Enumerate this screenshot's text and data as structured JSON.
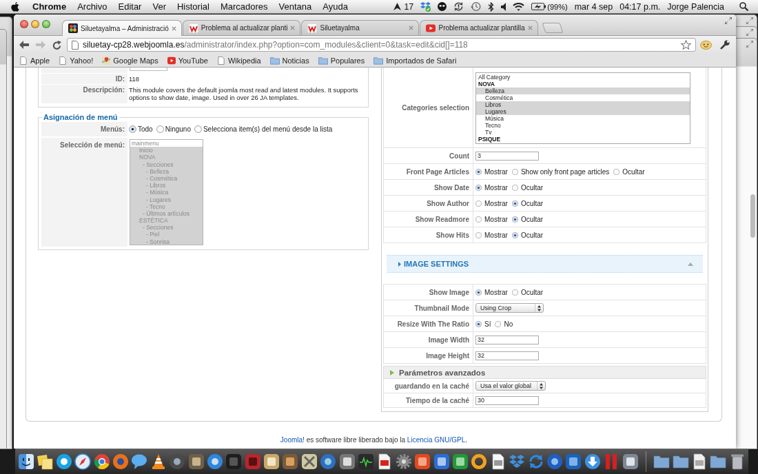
{
  "menu_bar": {
    "app": "Chrome",
    "menus": [
      "Archivo",
      "Editar",
      "Ver",
      "Historial",
      "Marcadores",
      "Ventana",
      "Ayuda"
    ],
    "status": {
      "count": "17",
      "battery": "(99%)",
      "date": "mar 4 sep",
      "time": "04:17 p.m.",
      "user": "Jorge Palencia"
    }
  },
  "browser": {
    "tabs": [
      {
        "kind": "logo",
        "title": "Siluetayalma – Administració",
        "selected": true
      },
      {
        "kind": "letter",
        "title": "Problema al actualizar planti",
        "selected": false
      },
      {
        "kind": "letter",
        "title": "Siluetayalma",
        "selected": false
      },
      {
        "kind": "video",
        "title": "Problema actualizar plantilla",
        "selected": false
      }
    ],
    "nav_buttons": [
      {
        "kind": "back",
        "disabled": false
      },
      {
        "kind": "forward",
        "disabled": true
      },
      {
        "kind": "reload",
        "disabled": false
      }
    ],
    "address": {
      "host": "siluetay-cp28.webjoomla.es",
      "path": "/administrator/index.php?option=com_modules&client=0&task=edit&cid[]=118"
    },
    "bookmarks": [
      {
        "kind": "page",
        "label": "Apple"
      },
      {
        "kind": "page",
        "label": "Yahoo!"
      },
      {
        "kind": "map",
        "label": "Google Maps"
      },
      {
        "kind": "video",
        "label": "YouTube"
      },
      {
        "kind": "page",
        "label": "Wikipedia"
      },
      {
        "kind": "folder",
        "label": "Noticias"
      },
      {
        "kind": "folder",
        "label": "Populares"
      },
      {
        "kind": "folder",
        "label": "Importados de Safari"
      }
    ]
  },
  "details": {
    "rows": [
      {
        "kind": "field"
      },
      {
        "kind": "text",
        "label": "ID:",
        "value": "118"
      },
      {
        "kind": "text",
        "label": "Descripción:",
        "value": "This module covers the default joomla most read and latest modules. It supports options to show date, image. Used in over 26 JA templates."
      }
    ]
  },
  "menu_assignment": {
    "legend": "Asignación de menú",
    "menus": {
      "label": "Menús:",
      "options": [
        {
          "label": "Todo",
          "selected": true
        },
        {
          "label": "Ninguno",
          "selected": false
        },
        {
          "label": "Selecciona item(s) del menú desde la lista",
          "selected": false
        }
      ]
    },
    "selection": {
      "label": "Selección de menú:",
      "disabled": true,
      "items": [
        {
          "label": "mainmenu",
          "selected": false,
          "children": [
            {
              "label": "Inicio",
              "selected": true
            },
            {
              "label": "NOVA",
              "selected": true,
              "children": [
                {
                  "label": "- Secciones",
                  "selected": true,
                  "children": [
                    {
                      "label": "- Belleza",
                      "selected": true
                    },
                    {
                      "label": "- Cosmética",
                      "selected": true
                    },
                    {
                      "label": "- Libros",
                      "selected": true
                    },
                    {
                      "label": "- Música",
                      "selected": true
                    },
                    {
                      "label": "- Lugares",
                      "selected": true
                    },
                    {
                      "label": "- Tecno",
                      "selected": true
                    }
                  ]
                },
                {
                  "label": "- Últimos artículos",
                  "selected": true
                }
              ]
            },
            {
              "label": "ESTÉTICA",
              "selected": true,
              "children": [
                {
                  "label": "- Secciones",
                  "selected": true,
                  "children": [
                    {
                      "label": "- Piel",
                      "selected": true
                    },
                    {
                      "label": "- Sonrisa",
                      "selected": true
                    }
                  ]
                }
              ]
            }
          ]
        }
      ]
    }
  },
  "module_params": {
    "rows": [
      {
        "kind": "listbox",
        "label": "Categories selection",
        "items": [
          {
            "kind": "option",
            "label": "All Category",
            "selected": false
          },
          {
            "kind": "group",
            "label": "NOVA",
            "children": [
              {
                "kind": "option",
                "label": "Belleza",
                "selected": true
              },
              {
                "kind": "option",
                "label": "Cosmética",
                "selected": false
              },
              {
                "kind": "option",
                "label": "Libros",
                "selected": true
              },
              {
                "kind": "option",
                "label": "Lugares",
                "selected": true
              },
              {
                "kind": "option",
                "label": "Música",
                "selected": false
              },
              {
                "kind": "option",
                "label": "Tecno",
                "selected": false
              },
              {
                "kind": "option",
                "label": "Tv",
                "selected": false
              }
            ]
          },
          {
            "kind": "group",
            "label": "PSIQUE"
          }
        ]
      },
      {
        "kind": "text",
        "label": "Count",
        "value": "3"
      },
      {
        "kind": "radio",
        "label": "Front Page Articles",
        "options": [
          {
            "label": "Mostrar",
            "selected": true
          },
          {
            "label": "Show only front page articles",
            "selected": false
          },
          {
            "label": "Ocultar",
            "selected": false
          }
        ]
      },
      {
        "kind": "radio",
        "label": "Show Date",
        "options": [
          {
            "label": "Mostrar",
            "selected": true
          },
          {
            "label": "Ocultar",
            "selected": false
          }
        ]
      },
      {
        "kind": "radio",
        "label": "Show Author",
        "options": [
          {
            "label": "Mostrar",
            "selected": false
          },
          {
            "label": "Ocultar",
            "selected": true
          }
        ]
      },
      {
        "kind": "radio",
        "label": "Show Readmore",
        "options": [
          {
            "label": "Mostrar",
            "selected": false
          },
          {
            "label": "Ocultar",
            "selected": true
          }
        ]
      },
      {
        "kind": "radio",
        "label": "Show Hits",
        "options": [
          {
            "label": "Mostrar",
            "selected": false
          },
          {
            "label": "Ocultar",
            "selected": true
          }
        ]
      }
    ]
  },
  "image_settings": {
    "title": "IMAGE SETTINGS",
    "rows": [
      {
        "kind": "radio",
        "label": "Show Image",
        "options": [
          {
            "label": "Mostrar",
            "selected": true
          },
          {
            "label": "Ocultar",
            "selected": false
          }
        ]
      },
      {
        "kind": "select",
        "label": "Thumbnail Mode",
        "value": "Using Crop"
      },
      {
        "kind": "radio",
        "label": "Resize With The Ratio",
        "options": [
          {
            "label": "Sí",
            "selected": true
          },
          {
            "label": "No",
            "selected": false
          }
        ]
      },
      {
        "kind": "text",
        "label": "Image Width",
        "value": "32"
      },
      {
        "kind": "text",
        "label": "Image Height",
        "value": "32"
      }
    ]
  },
  "advanced": {
    "title": "Parámetros avanzados",
    "rows": [
      {
        "kind": "select",
        "label": "guardando en la caché",
        "value": "Usa el valor global"
      },
      {
        "kind": "text",
        "label": "Tiempo de la caché",
        "value": "30"
      }
    ]
  },
  "footer": {
    "parts": [
      {
        "kind": "link",
        "text": "Joomla!"
      },
      {
        "kind": "text",
        "text": " es software libre liberado bajo la "
      },
      {
        "kind": "link",
        "text": "Licencia GNU/GPL"
      },
      {
        "kind": "text",
        "text": "."
      }
    ]
  }
}
